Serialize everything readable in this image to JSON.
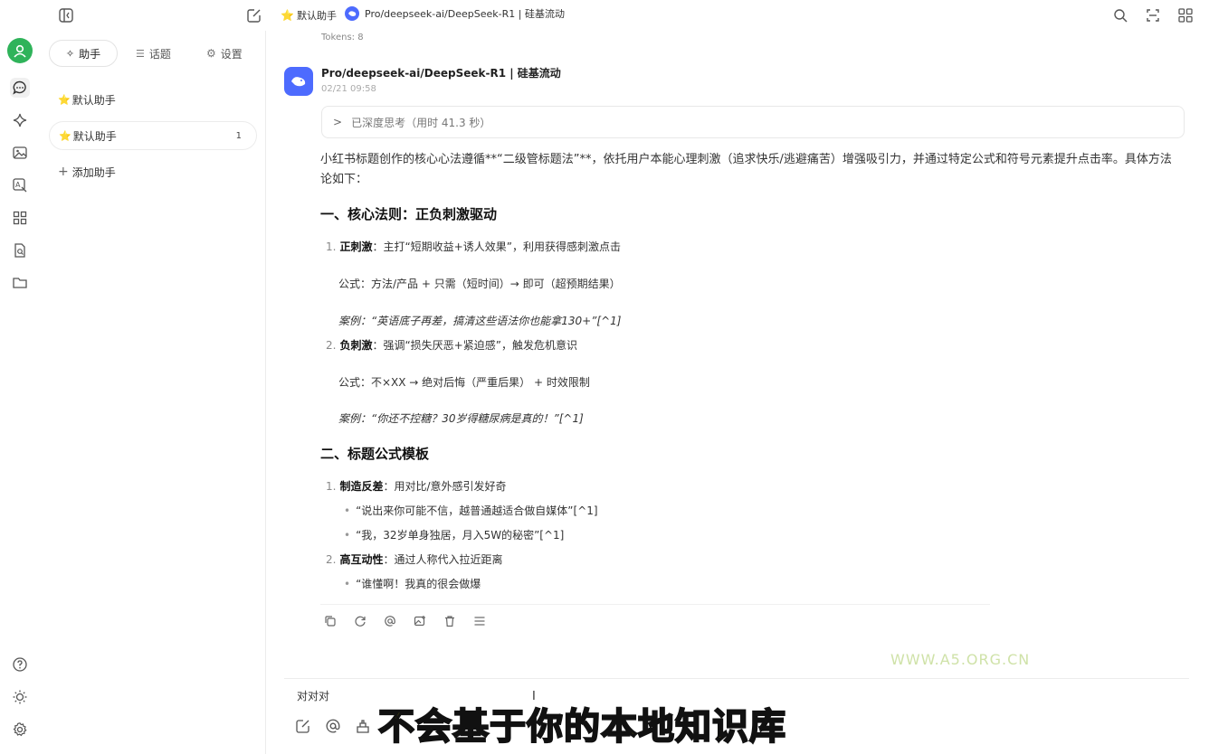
{
  "topbar": {
    "assistant_name": "默认助手",
    "model_title": "Pro/deepseek-ai/DeepSeek-R1 | 硅基流动"
  },
  "sidebar": {
    "tabs": [
      {
        "label": "助手"
      },
      {
        "label": "话题"
      },
      {
        "label": "设置"
      }
    ],
    "assistants": [
      {
        "label": "默认助手",
        "badge": ""
      },
      {
        "label": "默认助手",
        "badge": "1"
      }
    ],
    "add_label": "添加助手"
  },
  "chat": {
    "tokens_label": "Tokens: 8",
    "sender": "Pro/deepseek-ai/DeepSeek-R1 | 硅基流动",
    "timestamp": "02/21 09:58",
    "thinking_label": "已深度思考（用时 41.3 秒）",
    "intro": "小红书标题创作的核心心法遵循**“二级管标题法”**，依托用户本能心理刺激（追求快乐/逃避痛苦）增强吸引力，并通过特定公式和符号元素提升点击率。具体方法论如下：",
    "section1_title": "一、核心法则：正负刺激驱动",
    "s1_item1_num": "1.",
    "s1_item1_bold": "正刺激",
    "s1_item1_text": "：主打“短期收益+诱人效果”，利用获得感刺激点击",
    "s1_item1_formula": "公式：方法/产品 + 只需（短时间）→ 即可（超预期结果）",
    "s1_item1_case": "案例：“英语底子再差，搞清这些语法你也能拿130+”[^1]",
    "s1_item2_num": "2.",
    "s1_item2_bold": "负刺激",
    "s1_item2_text": "：强调“损失厌恶+紧迫感”，触发危机意识",
    "s1_item2_formula": "公式：不×XX → 绝对后悔（严重后果） + 时效限制",
    "s1_item2_case": "案例：“你还不控糖？30岁得糖尿病是真的！”[^1]",
    "section2_title": "二、标题公式模板",
    "s2_item1_num": "1.",
    "s2_item1_bold": "制造反差",
    "s2_item1_text": "：用对比/意外感引发好奇",
    "s2_item1_b1": "“说出来你可能不信，越普通越适合做自媒体”[^1]",
    "s2_item1_b2": "“我，32岁单身独居，月入5W的秘密”[^1]",
    "s2_item2_num": "2.",
    "s2_item2_bold": "高互动性",
    "s2_item2_text": "：通过人称代入拉近距离",
    "s2_item2_b1": "“谁懂啊！我真的很会做爆"
  },
  "input": {
    "value": "对对对"
  },
  "overlay": {
    "caption": "不会基于你的本地知识库",
    "watermark": "WWW.A5.ORG.CN"
  },
  "colors": {
    "avatar_green": "#2fb35a",
    "caption_yellow": "#f4e600",
    "model_logo_blue": "#4d6bfe"
  }
}
